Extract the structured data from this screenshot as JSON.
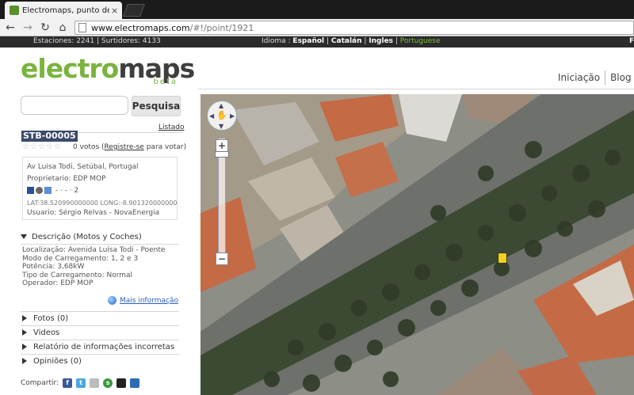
{
  "browser": {
    "tab_title": "Electromaps, punto de recarg",
    "tab_close": "×",
    "url_host": "www.electromaps.com",
    "url_path": "/#!/point/1921"
  },
  "topstrip": {
    "stations_label": "Estaciones: ",
    "stations_count": "2241",
    "sep": " | ",
    "outlets_label": "Surtidores: ",
    "outlets_count": "4133",
    "language_label": "Idioma : ",
    "languages": [
      "Español",
      "Catalán",
      "Ingles",
      "Portuguese"
    ],
    "f": "F"
  },
  "logo": {
    "part1": "electro",
    "part2": "maps",
    "beta": "beta"
  },
  "nav": {
    "items": [
      "Iniciação",
      "Blog"
    ]
  },
  "search": {
    "button_label": "Pesquisa",
    "placeholder": "",
    "listado": "Listado"
  },
  "station": {
    "id": "STB-00005",
    "stars": "☆☆☆☆☆",
    "votes_count": "0 votos (",
    "register_link": "Registre-se",
    "votes_tail": " para votar)",
    "address": "Av Luisa Todi, Setúbal, Portugal",
    "owner": "Proprietario: EDP MOP",
    "icons_row": "-  ·  -  ·  2",
    "coords": "LAT:38.520990000000  LONG:-8.901320000000",
    "user": "Usuario: Sérgio Relvas - NovaEnergia"
  },
  "description": {
    "heading": "Descrição (Motos y Coches)",
    "lines": [
      "Localização: Avenida Luísa Todi - Poente",
      "Modo de Carregamento: 1, 2 e 3",
      "Potência: 3,68kW",
      "Tipo de Carregamento: Normal",
      "Operador: EDP MOP"
    ],
    "more_link": "Mais informação"
  },
  "sections": [
    "Fotos (0)",
    "Videos",
    "Relatório de informações incorretas",
    "Opiniões (0)"
  ],
  "share": {
    "label": "Compartir:",
    "icons": [
      "facebook-icon",
      "twitter-icon",
      "delicious-icon",
      "stumbleupon-icon",
      "myspace-icon",
      "digg-icon"
    ]
  },
  "colors": {
    "brand_green": "#7ab33e",
    "id_bg": "#3a4a6a",
    "link_blue": "#2a62b8"
  }
}
